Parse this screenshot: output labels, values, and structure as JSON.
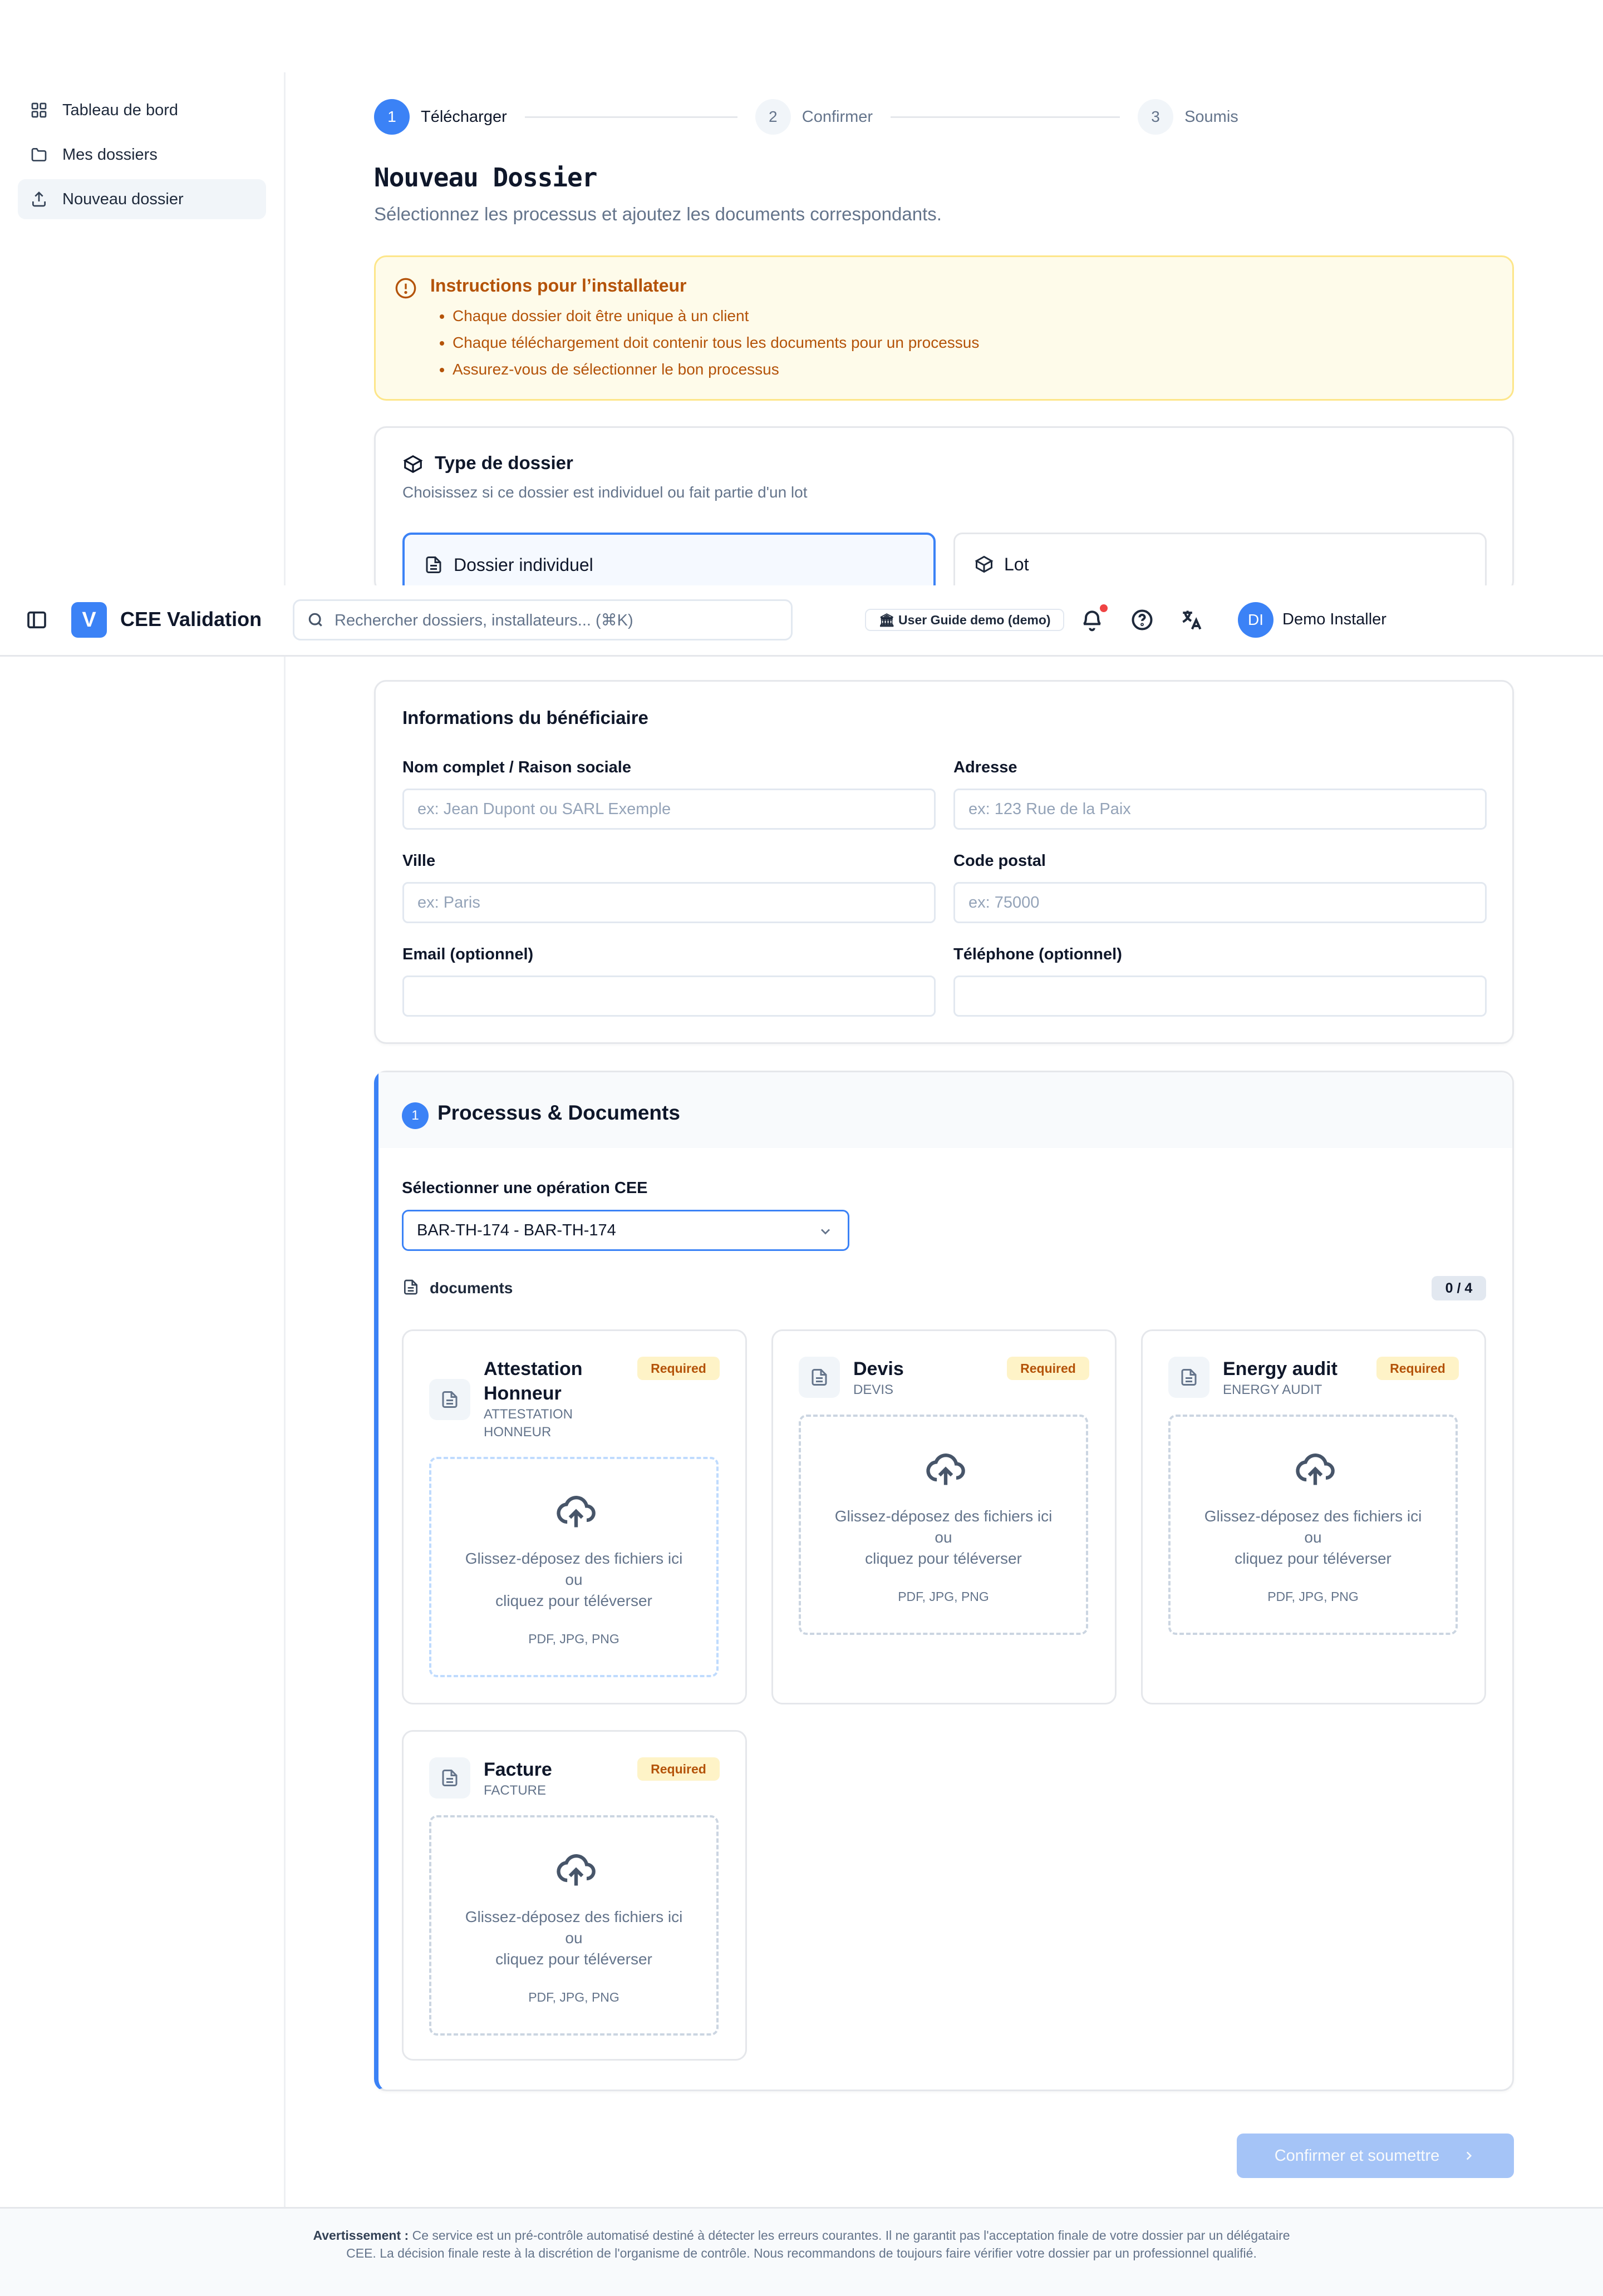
{
  "app": {
    "logo_letter": "V",
    "name": "CEE Validation"
  },
  "sidebar": {
    "items": [
      {
        "label": "Tableau de bord",
        "icon": "dashboard-icon"
      },
      {
        "label": "Mes dossiers",
        "icon": "folder-icon"
      },
      {
        "label": "Nouveau dossier",
        "icon": "upload-icon",
        "active": true
      }
    ]
  },
  "header": {
    "search_placeholder": "Rechercher dossiers, installateurs... (⌘K)",
    "guide_label": "🏛 User Guide demo (demo)",
    "user_initials": "DI",
    "user_name": "Demo Installer"
  },
  "stepper": {
    "steps": [
      {
        "num": "1",
        "label": "Télécharger",
        "active": true
      },
      {
        "num": "2",
        "label": "Confirmer",
        "active": false
      },
      {
        "num": "3",
        "label": "Soumis",
        "active": false
      }
    ]
  },
  "page": {
    "title": "Nouveau Dossier",
    "subtitle": "Sélectionnez les processus et ajoutez les documents correspondants."
  },
  "instructions": {
    "title": "Instructions pour l’installateur",
    "items": [
      "Chaque dossier doit être unique à un client",
      "Chaque téléchargement doit contenir tous les documents pour un processus",
      "Assurez-vous de sélectionner le bon processus"
    ]
  },
  "type_dossier": {
    "title": "Type de dossier",
    "description": "Choisissez si ce dossier est individuel ou fait partie d'un lot",
    "options": [
      "Dossier individuel",
      "Lot"
    ],
    "selected": "Dossier individuel"
  },
  "beneficiaire": {
    "title": "Informations du bénéficiaire",
    "fields": [
      {
        "label": "Nom complet / Raison sociale",
        "placeholder": "ex: Jean Dupont ou SARL Exemple",
        "value": ""
      },
      {
        "label": "Adresse",
        "placeholder": "ex: 123 Rue de la Paix",
        "value": ""
      },
      {
        "label": "Ville",
        "placeholder": "ex: Paris",
        "value": ""
      },
      {
        "label": "Code postal",
        "placeholder": "ex: 75000",
        "value": ""
      },
      {
        "label": "Email (optionnel)",
        "placeholder": "",
        "value": ""
      },
      {
        "label": "Téléphone (optionnel)",
        "placeholder": "",
        "value": ""
      }
    ]
  },
  "processus": {
    "number": "1",
    "title": "Processus & Documents",
    "select_label": "Sélectionner une opération CEE",
    "select_value": "BAR-TH-174 - BAR-TH-174",
    "documents_label": "documents",
    "documents_count": "0 / 4",
    "documents": [
      {
        "title": "Attestation Honneur",
        "code": "ATTESTATION HONNEUR",
        "badge": "Required"
      },
      {
        "title": "Devis",
        "code": "DEVIS",
        "badge": "Required"
      },
      {
        "title": "Energy audit",
        "code": "ENERGY AUDIT",
        "badge": "Required"
      },
      {
        "title": "Facture",
        "code": "FACTURE",
        "badge": "Required"
      }
    ],
    "dropzone": {
      "line1": "Glissez-déposez des fichiers ici",
      "line2": "ou",
      "line3": "cliquez pour téléverser",
      "formats": "PDF, JPG, PNG"
    }
  },
  "actions": {
    "submit_label": "Confirmer et soumettre"
  },
  "footer": {
    "warning_label": "Avertissement :",
    "warning_text": "Ce service est un pré-contrôle automatisé destiné à détecter les erreurs courantes. Il ne garantit pas l'acceptation finale de votre dossier par un délégataire CEE. La décision finale reste à la discrétion de l'organisme de contrôle. Nous recommandons de toujours faire vérifier votre dossier par un professionnel qualifié."
  },
  "colors": {
    "accent": "#3b82f6",
    "warning_bg": "#fefbea",
    "warning_text": "#b45309",
    "badge_bg": "#fef3c7"
  }
}
